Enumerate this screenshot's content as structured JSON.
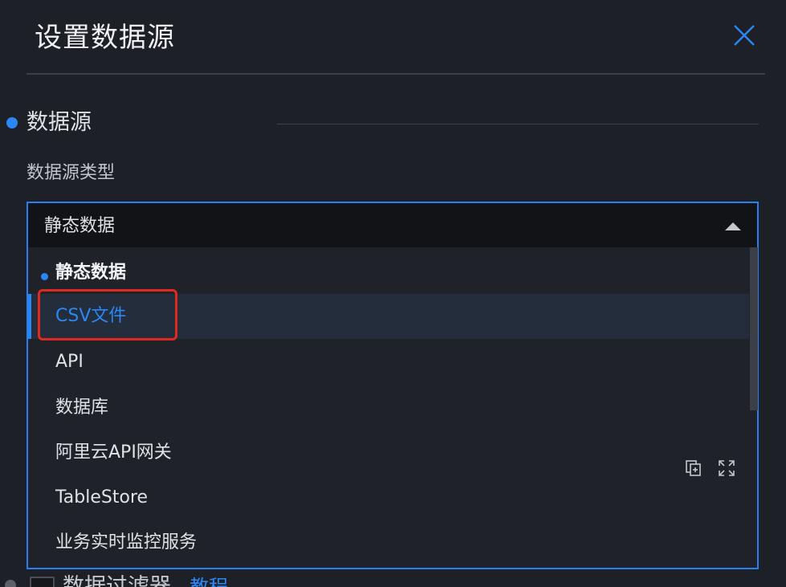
{
  "header": {
    "title": "设置数据源"
  },
  "section": {
    "title": "数据源"
  },
  "field": {
    "label": "数据源类型",
    "selected_value": "静态数据"
  },
  "dropdown": {
    "options": [
      {
        "label": "静态数据",
        "state": "selected"
      },
      {
        "label": "CSV文件",
        "state": "hovered"
      },
      {
        "label": "API",
        "state": "normal"
      },
      {
        "label": "数据库",
        "state": "normal"
      },
      {
        "label": "阿里云API网关",
        "state": "normal"
      },
      {
        "label": "TableStore",
        "state": "normal"
      },
      {
        "label": "业务实时监控服务",
        "state": "normal"
      }
    ]
  },
  "toolbar": {
    "icons": [
      "copy-icon",
      "expand-icon"
    ]
  },
  "bottom": {
    "label": "数据过滤器",
    "link": "教程"
  },
  "colors": {
    "accent": "#2b86f6",
    "highlight": "#e02a20",
    "background": "#1d2026"
  }
}
